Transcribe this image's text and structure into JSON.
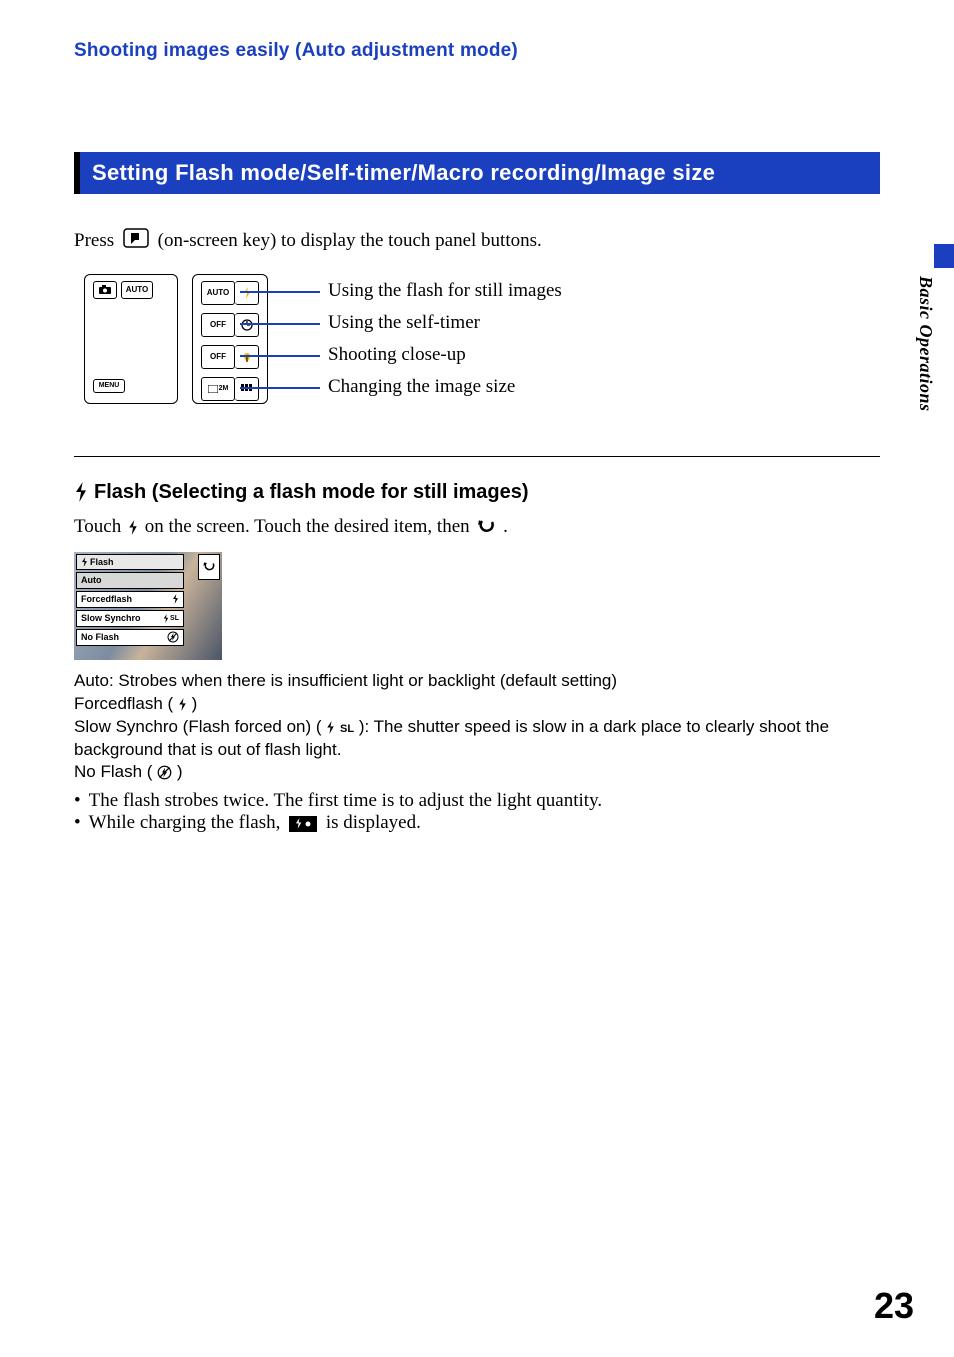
{
  "runningHead": "Shooting images easily (Auto adjustment mode)",
  "sectionTitle": "Setting Flash mode/Self-timer/Macro recording/Image size",
  "pressLine": {
    "before": "Press ",
    "after": " (on-screen key) to display the touch panel buttons."
  },
  "screen1": {
    "auto": "AUTO",
    "menu": "MENU"
  },
  "screen2": {
    "r1a": "AUTO",
    "r2a": "OFF",
    "r3a": "OFF",
    "r4a": "2M"
  },
  "callouts": {
    "c1": "Using the flash for still images",
    "c2": "Using the self-timer",
    "c3": "Shooting close-up",
    "c4": "Changing the image size"
  },
  "subhead": "Flash (Selecting a flash mode for still images)",
  "touchLine": {
    "t1": "Touch ",
    "t2": " on the screen. Touch the desired item, then ",
    "t3": " ."
  },
  "flashMenu": {
    "header": "Flash",
    "opt1": "Auto",
    "opt2": "Forcedflash",
    "opt3": "Slow Synchro",
    "opt3Suffix": "SL",
    "opt4": "No Flash"
  },
  "desc": {
    "l1": "Auto: Strobes when there is insufficient light or backlight (default setting)",
    "l2a": "Forcedflash (",
    "l2b": ")",
    "l3a": "Slow Synchro (Flash forced on) (",
    "l3suffix": "SL",
    "l3b": "): The shutter speed is slow in a dark place to clearly shoot the",
    "l4": "background that is out of flash light.",
    "l5a": "No Flash (",
    "l5b": ")"
  },
  "bullets": {
    "b1": "The flash strobes twice. The first time is to adjust the light quantity.",
    "b2a": "While charging the flash, ",
    "b2b": " is displayed."
  },
  "sideLabel": "Basic Operations",
  "pageNumber": "23"
}
